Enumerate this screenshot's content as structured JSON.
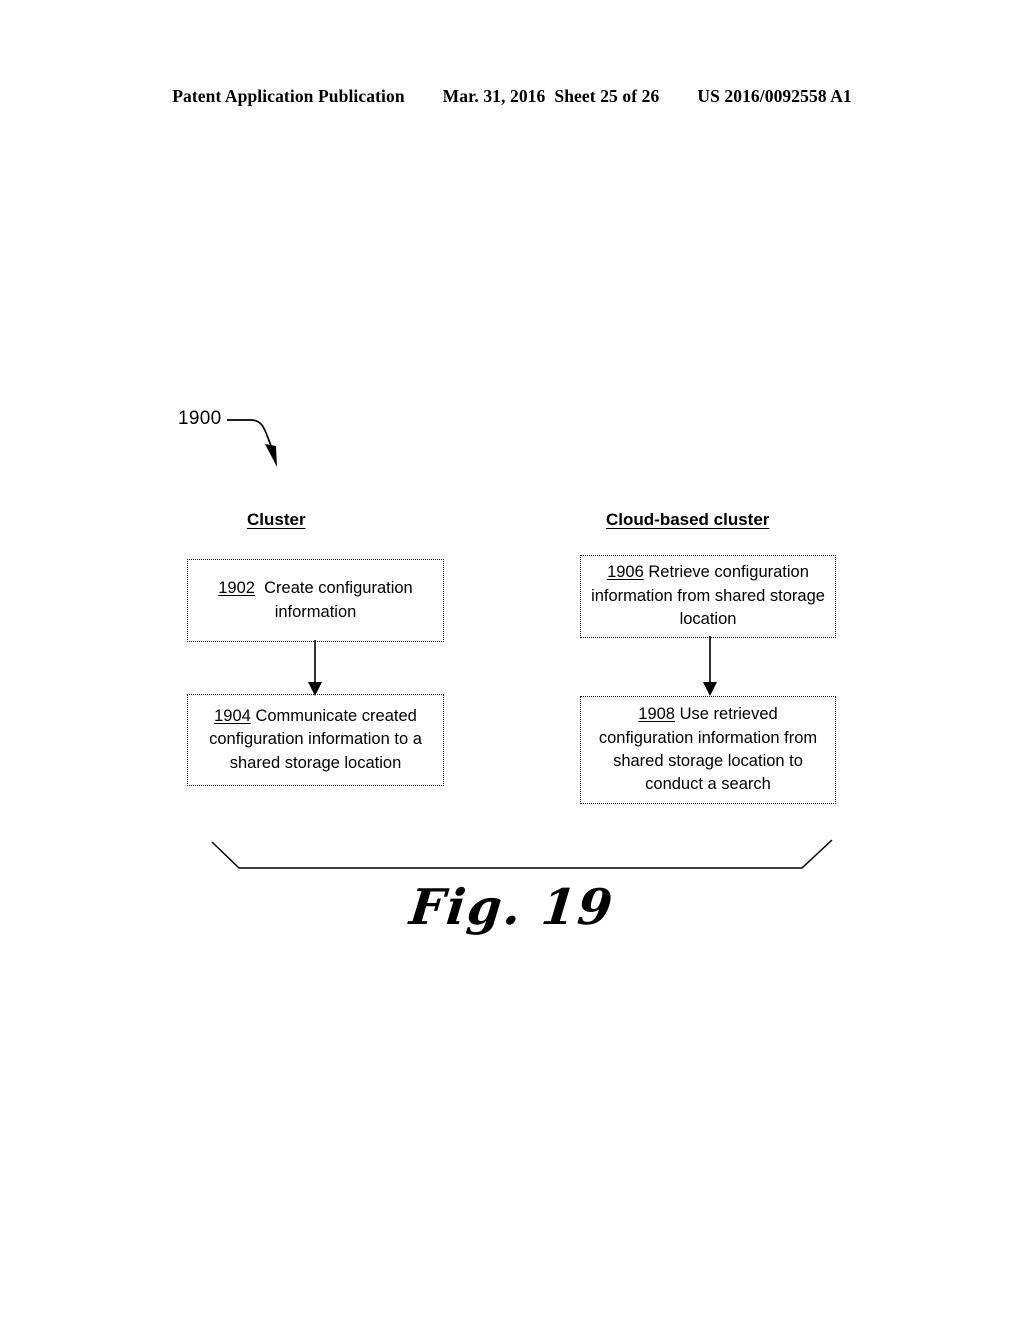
{
  "header": {
    "publication": "Patent Application Publication",
    "date": "Mar. 31, 2016",
    "sheet": "Sheet 25 of 26",
    "patent_number": "US 2016/0092558 A1"
  },
  "figure": {
    "reference_numeral": "1900",
    "caption": "Fig. 19"
  },
  "lanes": [
    {
      "id": "cluster",
      "label": "Cluster"
    },
    {
      "id": "cloud-based-cluster",
      "label": "Cloud-based cluster"
    }
  ],
  "steps": [
    {
      "number": "1902",
      "text": "Create configuration information",
      "lane": "cluster"
    },
    {
      "number": "1904",
      "text": "Communicate created configuration information to a shared storage location",
      "lane": "cluster"
    },
    {
      "number": "1906",
      "text": "Retrieve configuration information from shared storage location",
      "lane": "cloud-based-cluster"
    },
    {
      "number": "1908",
      "text": "Use retrieved configuration information from shared storage location to conduct a search",
      "lane": "cloud-based-cluster"
    }
  ],
  "colors": {
    "ink": "#000000",
    "page": "#ffffff"
  }
}
